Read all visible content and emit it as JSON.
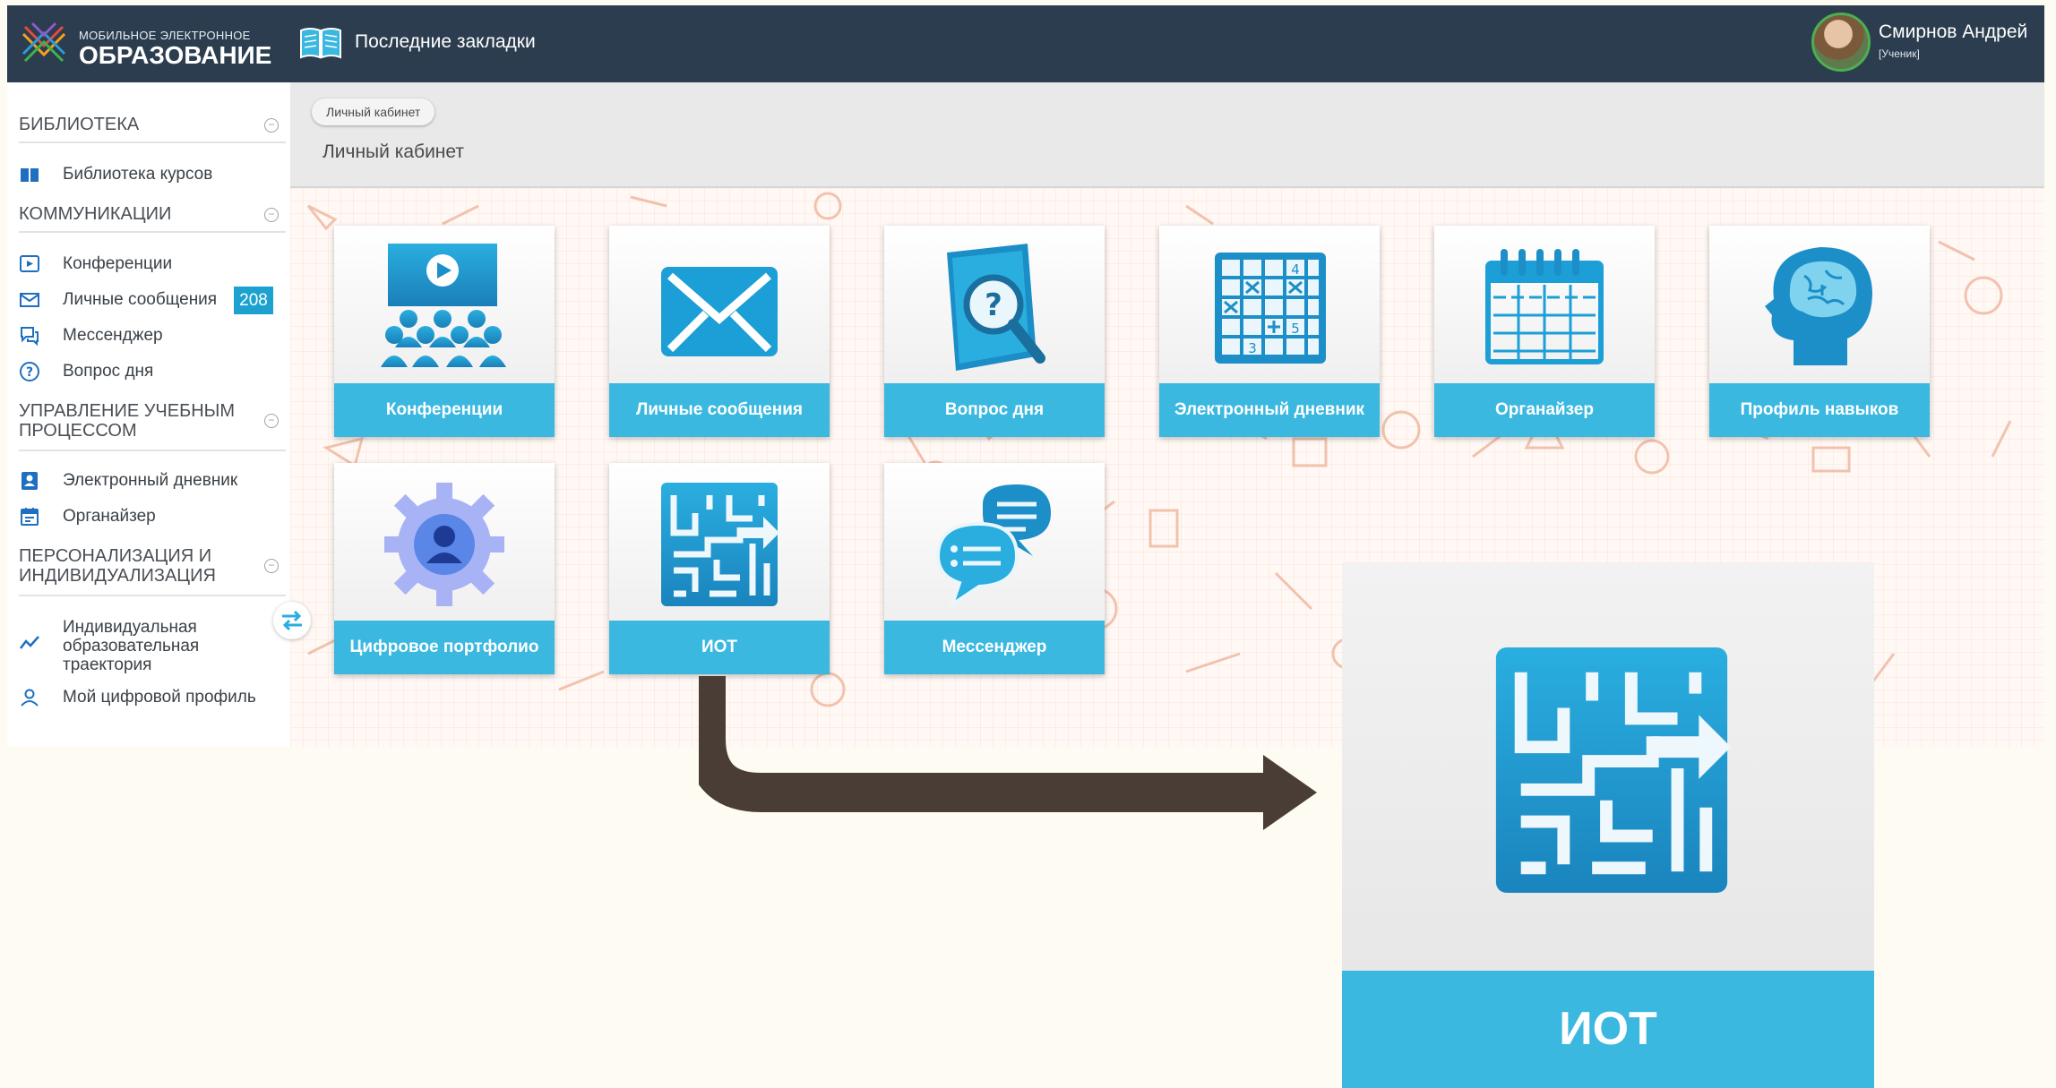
{
  "header": {
    "logo_small": "МОБИЛЬНОЕ ЭЛЕКТРОННОЕ",
    "logo_big": "ОБРАЗОВАНИЕ",
    "bookmarks_label": "Последние закладки",
    "user_name": "Смирнов Андрей",
    "user_role": "[Ученик]"
  },
  "sidebar": {
    "sections": [
      {
        "title": "БИБЛИОТЕКА"
      },
      {
        "title": "КОММУНИКАЦИИ"
      },
      {
        "title": "УПРАВЛЕНИЕ УЧЕБНЫМ ПРОЦЕССОМ"
      },
      {
        "title": "ПЕРСОНАЛИЗАЦИЯ И ИНДИВИДУАЛИЗАЦИЯ"
      }
    ],
    "items": [
      {
        "label": "Библиотека курсов",
        "icon": "book-icon"
      },
      {
        "label": "Конференции",
        "icon": "play-icon"
      },
      {
        "label": "Личные сообщения",
        "icon": "mail-icon",
        "badge": "208"
      },
      {
        "label": "Мессенджер",
        "icon": "chat-icon"
      },
      {
        "label": "Вопрос дня",
        "icon": "question-icon"
      },
      {
        "label": "Электронный дневник",
        "icon": "diary-icon"
      },
      {
        "label": "Органайзер",
        "icon": "calendar-icon"
      },
      {
        "label": "Индивидуальная образовательная траектория",
        "icon": "trajectory-icon"
      },
      {
        "label": "Мой цифровой профиль",
        "icon": "user-icon"
      }
    ]
  },
  "content": {
    "breadcrumb": "Личный кабинет",
    "page_title": "Личный кабинет",
    "tiles": [
      {
        "label": "Конференции",
        "icon": "conference-icon"
      },
      {
        "label": "Личные сообщения",
        "icon": "envelope-icon"
      },
      {
        "label": "Вопрос дня",
        "icon": "question-book-icon"
      },
      {
        "label": "Электронный дневник",
        "icon": "grid-diary-icon"
      },
      {
        "label": "Органайзер",
        "icon": "organizer-icon"
      },
      {
        "label": "Профиль навыков",
        "icon": "brain-icon"
      },
      {
        "label": "Цифровое портфолио",
        "icon": "portfolio-gear-icon"
      },
      {
        "label": "ИОТ",
        "icon": "maze-icon"
      },
      {
        "label": "Мессенджер",
        "icon": "speech-bubbles-icon"
      }
    ]
  },
  "zoom": {
    "label": "ИОТ",
    "icon": "maze-icon"
  },
  "colors": {
    "header": "#2c3d4f",
    "accent": "#3bb8e0",
    "badge": "#1da2d0",
    "arrow": "#4a3d35"
  }
}
